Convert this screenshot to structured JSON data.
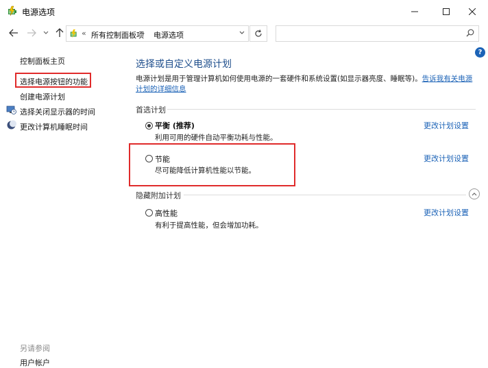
{
  "window": {
    "title": "电源选项",
    "minimize_icon": "minimize-icon",
    "maximize_icon": "maximize-icon",
    "close_icon": "close-icon"
  },
  "address": {
    "crumbs": [
      "所有控制面板项",
      "电源选项"
    ],
    "prefix": "«",
    "separator": "›",
    "search_value": "",
    "search_placeholder": ""
  },
  "sidebar": {
    "items": [
      {
        "label": "控制面板主页"
      },
      {
        "label": "选择电源按钮的功能",
        "highlighted": true
      },
      {
        "label": "创建电源计划"
      },
      {
        "label": "选择关闭显示器的时间",
        "icon": "monitor-clock-icon"
      },
      {
        "label": "更改计算机睡眠时间",
        "icon": "moon-icon"
      }
    ],
    "see_also_label": "另请参阅",
    "see_also_items": [
      {
        "label": "用户帐户"
      }
    ]
  },
  "main": {
    "title": "选择或自定义电源计划",
    "description": "电源计划是用于管理计算机如何使用电源的一套硬件和系统设置(如显示器亮度、睡眠等)。",
    "description_link": "告诉我有关电源计划的详细信息",
    "preferred_label": "首选计划",
    "hidden_label": "隐藏附加计划",
    "change_link": "更改计划设置",
    "plans": [
      {
        "name": "平衡 (推荐)",
        "desc": "利用可用的硬件自动平衡功耗与性能。",
        "selected": true
      },
      {
        "name": "节能",
        "desc": "尽可能降低计算机性能以节能。",
        "selected": false
      },
      {
        "name": "高性能",
        "desc": "有利于提高性能，但会增加功耗。",
        "selected": false
      }
    ]
  },
  "colors": {
    "accent": "#1c63b7",
    "title": "#1e4e8c",
    "highlight": "#e02a2a"
  }
}
